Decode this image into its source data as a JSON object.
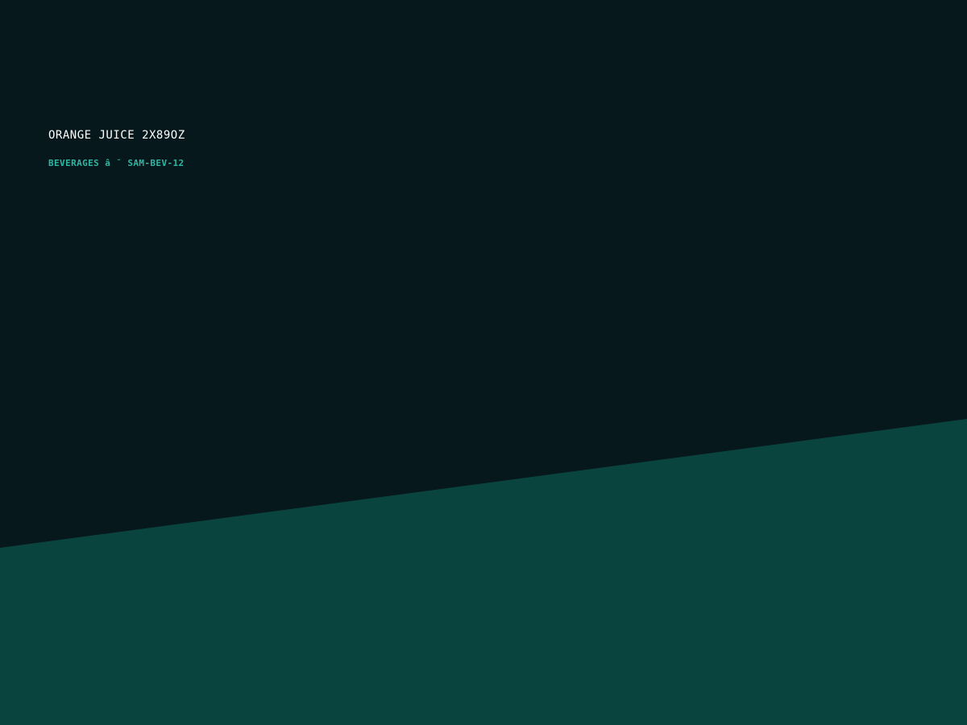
{
  "product": {
    "title": "ORANGE JUICE 2X89OZ",
    "meta": "BEVERAGES â ˘ SAM-BEV-12"
  },
  "colors": {
    "background": "#06181b",
    "wedge": "#09443f",
    "title": "#ffffff",
    "meta": "#2fb6a4"
  }
}
